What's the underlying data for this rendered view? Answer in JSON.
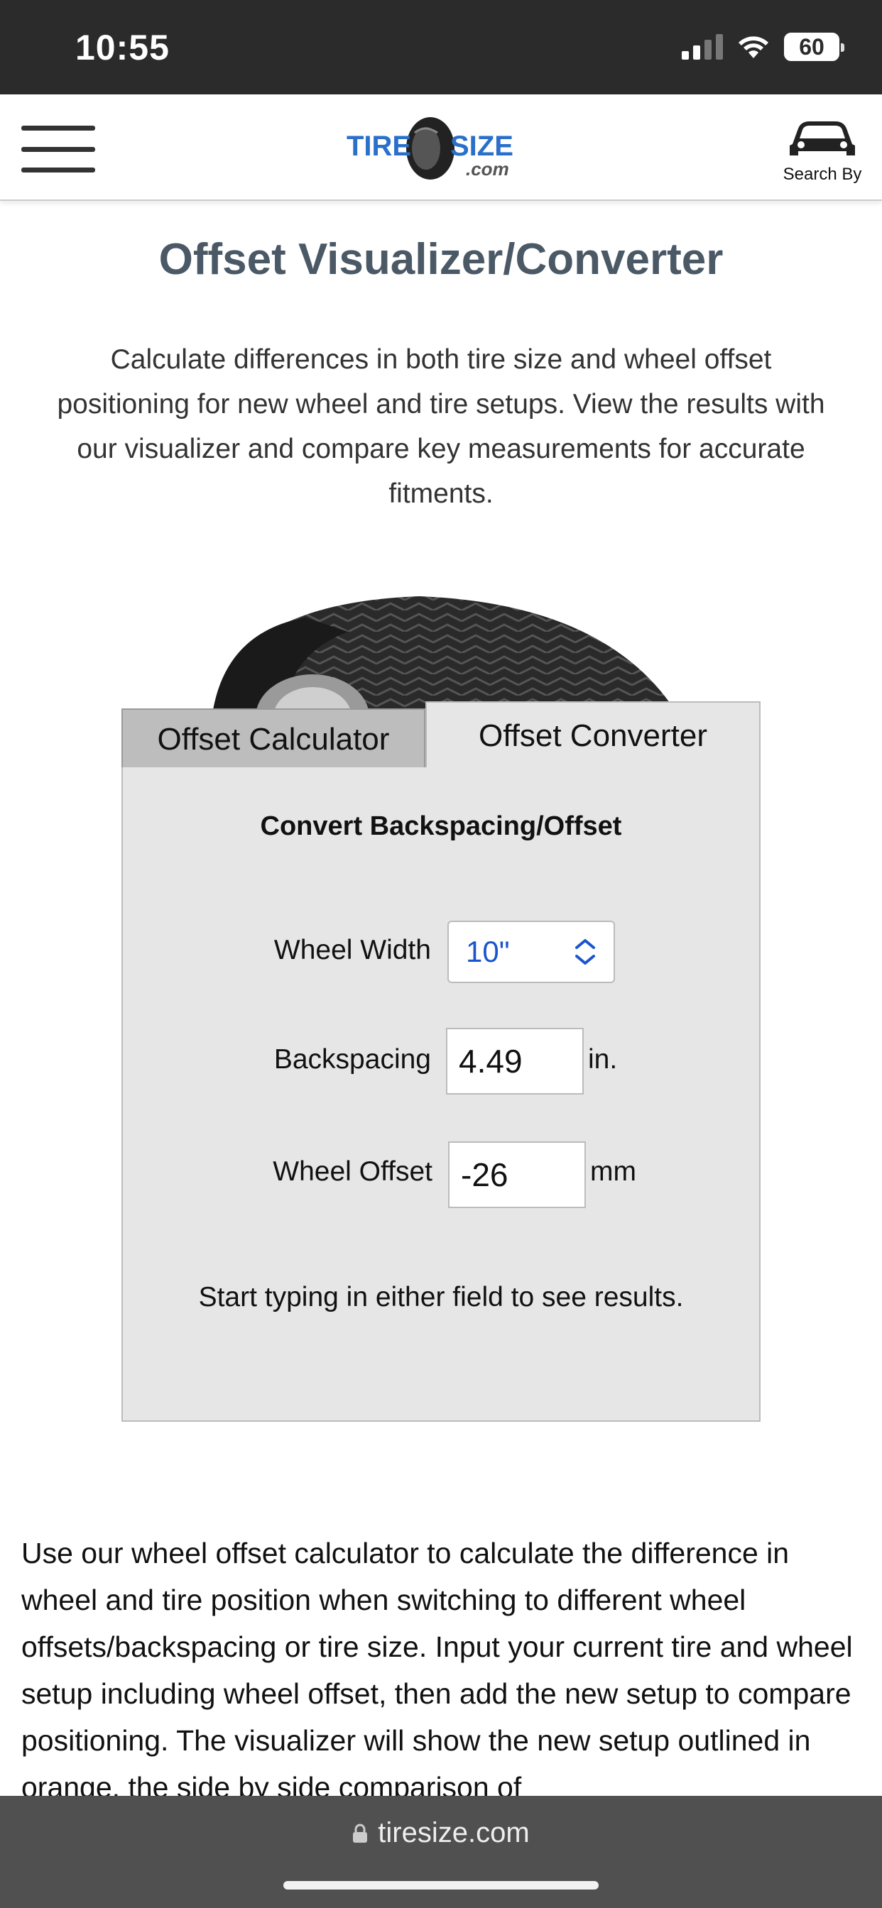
{
  "status_bar": {
    "time": "10:55",
    "battery": "60"
  },
  "header": {
    "logo_tire": "TIRE",
    "logo_size": "SIZE",
    "logo_com": ".com",
    "search_by_label": "Search By"
  },
  "main": {
    "title": "Offset Visualizer/Converter",
    "intro": "Calculate differences in both tire size and wheel offset positioning for new wheel and tire setups. View the results with our visualizer and compare key measurements for accurate fitments.",
    "tabs": [
      {
        "label": "Offset Calculator",
        "active": false
      },
      {
        "label": "Offset Converter",
        "active": true
      }
    ],
    "converter": {
      "heading": "Convert Backspacing/Offset",
      "wheel_width_label": "Wheel Width",
      "wheel_width_value": "10\"",
      "backspacing_label": "Backspacing",
      "backspacing_value": "4.49",
      "backspacing_unit": "in.",
      "offset_label": "Wheel Offset",
      "offset_value": "-26",
      "offset_unit": "mm",
      "hint": "Start typing in either field to see results."
    },
    "body_text": "Use our wheel offset calculator to calculate the difference in wheel and tire position when switching to different wheel offsets/backspacing or tire size. Input your current tire and wheel setup including wheel offset, then add the new setup to compare positioning. The visualizer will show the new setup outlined in orange, the side by side comparison of"
  },
  "browser": {
    "url": "tiresize.com"
  },
  "colors": {
    "title": "#4b5966",
    "logo_blue": "#2a6fc9",
    "select_text": "#1a55cc",
    "panel_bg": "#e6e6e6",
    "inactive_tab": "#bdbdbd"
  }
}
